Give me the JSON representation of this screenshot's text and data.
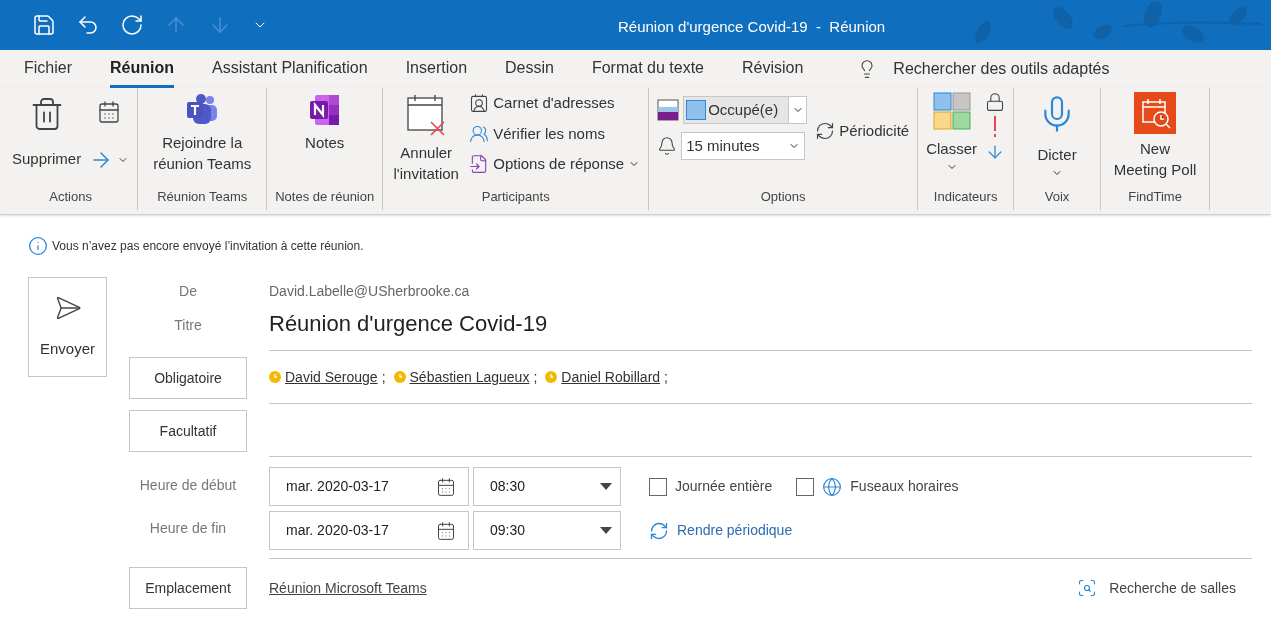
{
  "title_bar": {
    "title": "Réunion d'urgence Covid-19  -  Réunion",
    "quick_access": [
      {
        "kind": "save",
        "disabled": false
      },
      {
        "kind": "undo",
        "disabled": false
      },
      {
        "kind": "redo",
        "disabled": false
      },
      {
        "kind": "up",
        "disabled": true
      },
      {
        "kind": "down",
        "disabled": true
      },
      {
        "kind": "customize",
        "disabled": false
      }
    ]
  },
  "tabs": [
    {
      "label": "Fichier",
      "selected": false
    },
    {
      "label": "Réunion",
      "selected": true
    },
    {
      "label": "Assistant Planification",
      "selected": false
    },
    {
      "label": "Insertion",
      "selected": false
    },
    {
      "label": "Dessin",
      "selected": false
    },
    {
      "label": "Format du texte",
      "selected": false
    },
    {
      "label": "Révision",
      "selected": false
    }
  ],
  "search": {
    "text": "Rechercher des outils adaptés"
  },
  "ribbon": [
    {
      "kind": "actions",
      "label": "Actions",
      "buttons": [
        "Supprimer"
      ]
    },
    {
      "kind": "teams",
      "label": "Réunion Teams",
      "buttons": [
        "Rejoindre la réunion Teams"
      ]
    },
    {
      "kind": "notes",
      "label": "Notes de réunion",
      "buttons": [
        "Notes"
      ]
    },
    {
      "kind": "participants",
      "label": "Participants",
      "buttons": [
        "Annuler l'invitation",
        "Carnet d'adresses",
        "Vérifier les noms",
        "Options de réponse"
      ]
    },
    {
      "kind": "options",
      "label": "Options",
      "buttons": [
        "Occupé(e)",
        "15 minutes",
        "Périodicité"
      ]
    },
    {
      "kind": "tags",
      "label": "Indicateurs",
      "buttons": [
        "Classer"
      ]
    },
    {
      "kind": "voice",
      "label": "Voix",
      "buttons": [
        "Dicter"
      ]
    },
    {
      "kind": "findtime",
      "label": "FindTime",
      "buttons": [
        "New Meeting Poll"
      ]
    }
  ],
  "info": "Vous n’avez pas encore envoyé l’invitation à cette réunion.",
  "send": "Envoyer",
  "from": {
    "label": "De",
    "value": "David.Labelle@USherbrooke.ca"
  },
  "subject": {
    "label": "Titre",
    "value": "Réunion d'urgence Covid-19"
  },
  "required": {
    "button": "Obligatoire",
    "attendees": [
      {
        "name": "David Serouge",
        "separator": ";"
      },
      {
        "name": "Sébastien Lagueux",
        "separator": ";"
      },
      {
        "name": "Daniel Robillard",
        "separator": ";"
      }
    ]
  },
  "optional": {
    "button": "Facultatif"
  },
  "start": {
    "label": "Heure de début",
    "date": "mar. 2020-03-17",
    "time": "08:30"
  },
  "end": {
    "label": "Heure de fin",
    "date": "mar. 2020-03-17",
    "time": "09:30"
  },
  "all_day": {
    "label": "Journée entière",
    "checked": false
  },
  "time_zones": {
    "label": "Fuseaux horaires",
    "checked": false
  },
  "recurrence": "Rendre périodique",
  "location": {
    "button": "Emplacement",
    "value": "Réunion Microsoft Teams",
    "room_finder": "Recherche de salles"
  }
}
